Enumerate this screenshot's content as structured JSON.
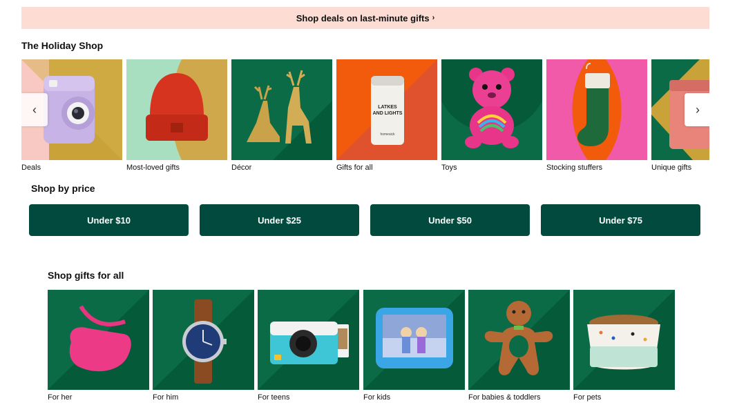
{
  "banner": {
    "label": "Shop deals on last-minute gifts",
    "chevron": "›"
  },
  "holiday_shop": {
    "title": "The Holiday Shop",
    "tiles": [
      {
        "label": "Deals"
      },
      {
        "label": "Most-loved gifts"
      },
      {
        "label": "Décor"
      },
      {
        "label": "Gifts for all"
      },
      {
        "label": "Toys"
      },
      {
        "label": "Stocking stuffers"
      },
      {
        "label": "Unique gifts"
      }
    ],
    "candle_text_1": "LATKES",
    "candle_text_2": "AND LIGHTS",
    "candle_brand": "homesick",
    "prev_arrow": "‹",
    "next_arrow": "›"
  },
  "shop_by_price": {
    "title": "Shop by price",
    "buttons": [
      {
        "label": "Under $10"
      },
      {
        "label": "Under $25"
      },
      {
        "label": "Under $50"
      },
      {
        "label": "Under $75"
      }
    ]
  },
  "gifts_for_all": {
    "title": "Shop gifts for all",
    "tiles": [
      {
        "label": "For her"
      },
      {
        "label": "For him"
      },
      {
        "label": "For teens"
      },
      {
        "label": "For kids"
      },
      {
        "label": "For babies & toddlers"
      },
      {
        "label": "For pets"
      }
    ]
  },
  "colors": {
    "banner_bg": "#fcdcd3",
    "price_button": "#024a3d",
    "tile_green": "#0b6b46",
    "tile_dark_green": "#055a3a",
    "tile_orange": "#f25a0c",
    "tile_pink": "#f05aa8",
    "tile_gold": "#c9a23a"
  }
}
